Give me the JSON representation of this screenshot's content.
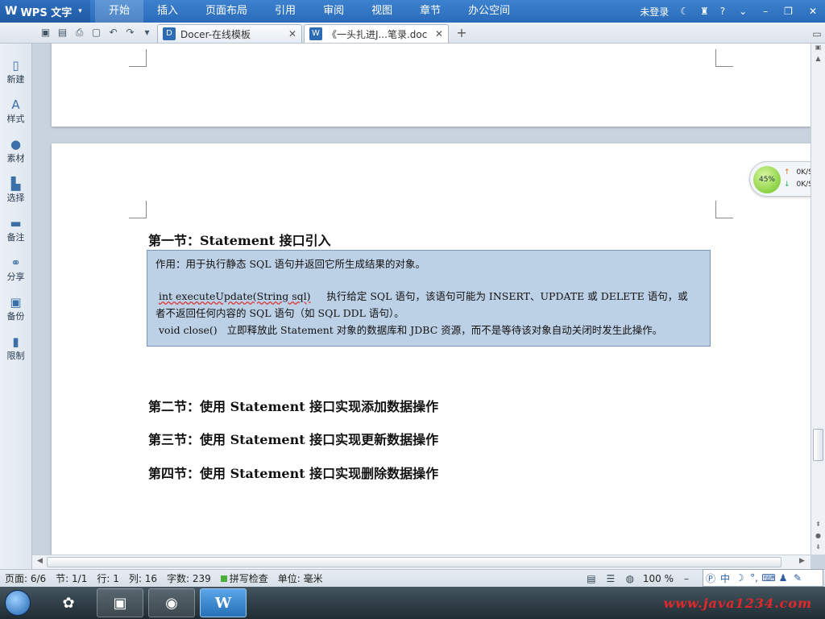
{
  "titlebar": {
    "app_name": "WPS 文字",
    "menus": [
      "开始",
      "插入",
      "页面布局",
      "引用",
      "审阅",
      "视图",
      "章节",
      "办公空间"
    ],
    "login": "未登录",
    "help": "?"
  },
  "tabs": [
    {
      "label": "Docer-在线模板",
      "icon": "D"
    },
    {
      "label": "《一头扎进J...笔录.doc",
      "icon": "W"
    }
  ],
  "sidebar": {
    "items": [
      {
        "label": "新建",
        "icon": "new-doc-icon"
      },
      {
        "label": "样式",
        "icon": "style-icon"
      },
      {
        "label": "素材",
        "icon": "material-icon"
      },
      {
        "label": "选择",
        "icon": "select-icon"
      },
      {
        "label": "备注",
        "icon": "note-icon"
      },
      {
        "label": "分享",
        "icon": "share-icon"
      },
      {
        "label": "备份",
        "icon": "backup-icon"
      },
      {
        "label": "限制",
        "icon": "restrict-icon"
      }
    ]
  },
  "document": {
    "section1_title": "第一节：Statement 接口引入",
    "box": {
      "line1": "作用：用于执行静态 SQL 语句并返回它所生成结果的对象。",
      "line2a": "int executeUpdate(String sql)",
      "line2b": "执行给定 SQL 语句，该语句可能为 INSERT、UPDATE 或 DELETE 语句，或",
      "line3": "者不返回任何内容的 SQL 语句（如 SQL DDL 语句）。",
      "line4a": "void close()",
      "line4b": "立即释放此 Statement 对象的数据库和 JDBC 资源，而不是等待该对象自动关闭时发生此操作。"
    },
    "section2_title": "第二节：使用 Statement 接口实现添加数据操作",
    "section3_title": "第三节：使用 Statement 接口实现更新数据操作",
    "section4_title": "第四节：使用 Statement 接口实现删除数据操作"
  },
  "net_widget": {
    "percent": "45%",
    "up": "0K/S",
    "down": "0K/S"
  },
  "statusbar": {
    "page": "页面: 6/6",
    "section": "节: 1/1",
    "row": "行: 1",
    "col": "列: 16",
    "chars": "字数: 239",
    "spell": "拼写检查",
    "unit": "单位: 毫米",
    "zoom": "100 %"
  },
  "ime": {
    "mode": "中"
  },
  "taskbar": {
    "watermark": "www.java1234.com"
  },
  "colors": {
    "title_bg": "#2a6bb8",
    "note_bg": "#bcd0e6",
    "watermark": "#e0282a"
  }
}
